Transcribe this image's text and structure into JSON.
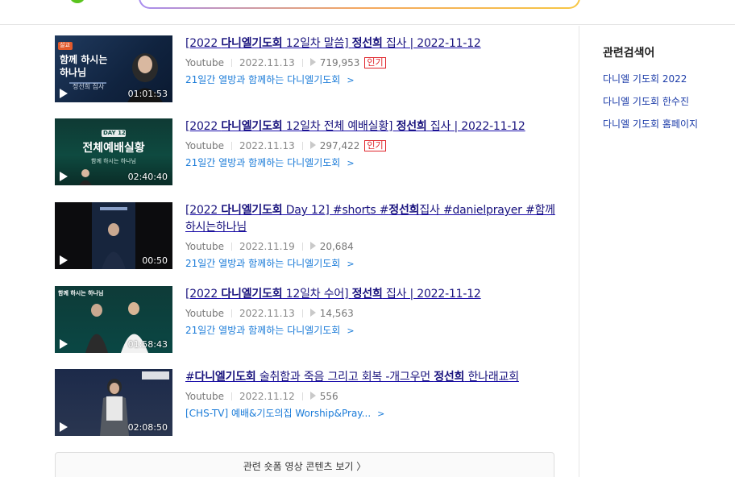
{
  "results": [
    {
      "title_parts": [
        "[2022 ",
        "다니엘기도회",
        " 12일차 말씀] ",
        "정선희",
        " 집사 | 2022-11-12"
      ],
      "source": "Youtube",
      "date": "2022.11.13",
      "views": "719,953",
      "badge": "인기",
      "channel": "21일간 열방과 함께하는 다니엘기도회",
      "duration": "01:01:53",
      "thumb_text_main": "함께 하시는\n하나님",
      "thumb_tag": "설교",
      "thumb_caption": "정선희 집사"
    },
    {
      "title_parts": [
        "[2022 ",
        "다니엘기도회",
        " 12일차 전체 예배실황] ",
        "정선희",
        " 집사 | 2022-11-12"
      ],
      "source": "Youtube",
      "date": "2022.11.13",
      "views": "297,422",
      "badge": "인기",
      "channel": "21일간 열방과 함께하는 다니엘기도회",
      "duration": "02:40:40",
      "thumb_text_main": "전체예배실황",
      "thumb_tag": "DAY 12",
      "thumb_caption": "함께 하시는 하나님"
    },
    {
      "title_parts": [
        "[2022 ",
        "다니엘기도회",
        " Day 12] #shorts #",
        "정선희",
        "집사 #danielprayer #함께하시는하나님"
      ],
      "source": "Youtube",
      "date": "2022.11.19",
      "views": "20,684",
      "badge": "",
      "channel": "21일간 열방과 함께하는 다니엘기도회",
      "duration": "00:50",
      "thumb_text_main": "",
      "thumb_tag": "",
      "thumb_caption": ""
    },
    {
      "title_parts": [
        "[2022 ",
        "다니엘기도회",
        " 12일차 수어] ",
        "정선희",
        " 집사 | 2022-11-12"
      ],
      "source": "Youtube",
      "date": "2022.11.13",
      "views": "14,563",
      "badge": "",
      "channel": "21일간 열방과 함께하는 다니엘기도회",
      "duration": "01:58:43",
      "thumb_text_main": "",
      "thumb_tag": "함께 하시는 하나님",
      "thumb_caption": ""
    },
    {
      "title_parts": [
        "#",
        "다니엘기도회",
        " 술취함과 죽음 그리고 회복 -개그우먼 ",
        "정선희",
        " 한나래교회"
      ],
      "source": "Youtube",
      "date": "2022.11.12",
      "views": "556",
      "badge": "",
      "channel": "[CHS-TV] 예배&기도의집 Worship&Pray...",
      "duration": "02:08:50",
      "thumb_text_main": "",
      "thumb_tag": "",
      "thumb_caption": ""
    }
  ],
  "more_button": "관련 숏폼 영상 콘텐츠 보기 〉",
  "sidebar": {
    "title": "관련검색어",
    "links": [
      "다니엘 기도회 2022",
      "다니엘 기도회 한수진",
      "다니엘 기도회 홈페이지"
    ]
  },
  "colors": {
    "title_link": "#18127d",
    "channel_link": "#1a7bd8",
    "badge": "#e0242b",
    "search_gradient_start": "#a78cf0",
    "search_gradient_end": "#f7c744",
    "logo_green": "#5ac41e"
  }
}
